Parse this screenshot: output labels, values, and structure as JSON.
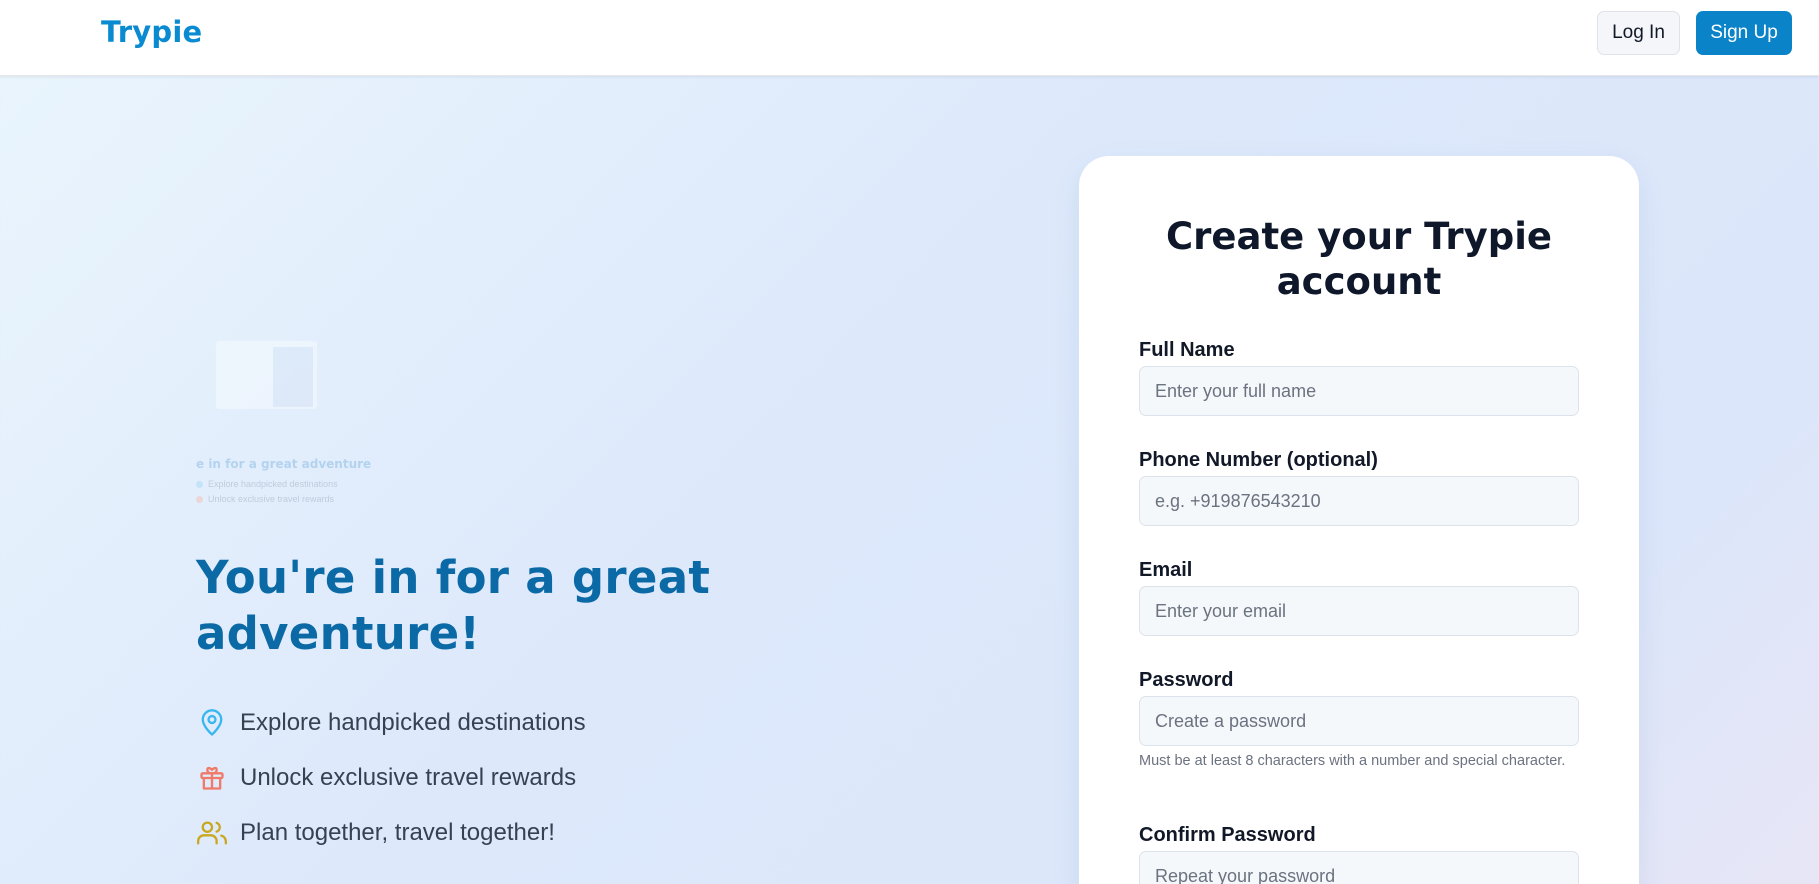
{
  "nav": {
    "logo": "Trypie",
    "login_label": "Log In",
    "signup_label": "Sign Up"
  },
  "thumbnail": {
    "heading": "e in for a great adventure",
    "rows": [
      "Explore handpicked destinations",
      "Unlock exclusive travel rewards"
    ]
  },
  "hero": {
    "title": "You're in for a great adventure!",
    "features": [
      {
        "icon": "map-pin-icon",
        "label": "Explore handpicked destinations",
        "color": "#38b6f0"
      },
      {
        "icon": "gift-icon",
        "label": "Unlock exclusive travel rewards",
        "color": "#f07a6a"
      },
      {
        "icon": "users-icon",
        "label": "Plan together, travel together!",
        "color": "#c9a820"
      }
    ]
  },
  "form": {
    "title": "Create your Trypie account",
    "full_name": {
      "label": "Full Name",
      "placeholder": "Enter your full name"
    },
    "phone": {
      "label": "Phone Number (optional)",
      "placeholder": "e.g. +919876543210"
    },
    "email": {
      "label": "Email",
      "placeholder": "Enter your email"
    },
    "password": {
      "label": "Password",
      "placeholder": "Create a password",
      "hint": "Must be at least 8 characters with a number and special character."
    },
    "confirm_password": {
      "label": "Confirm Password",
      "placeholder": "Repeat your password"
    }
  },
  "colors": {
    "brand": "#0a8bd1",
    "primary_button": "#0b83c9",
    "hero_title": "#0b6aa6"
  }
}
